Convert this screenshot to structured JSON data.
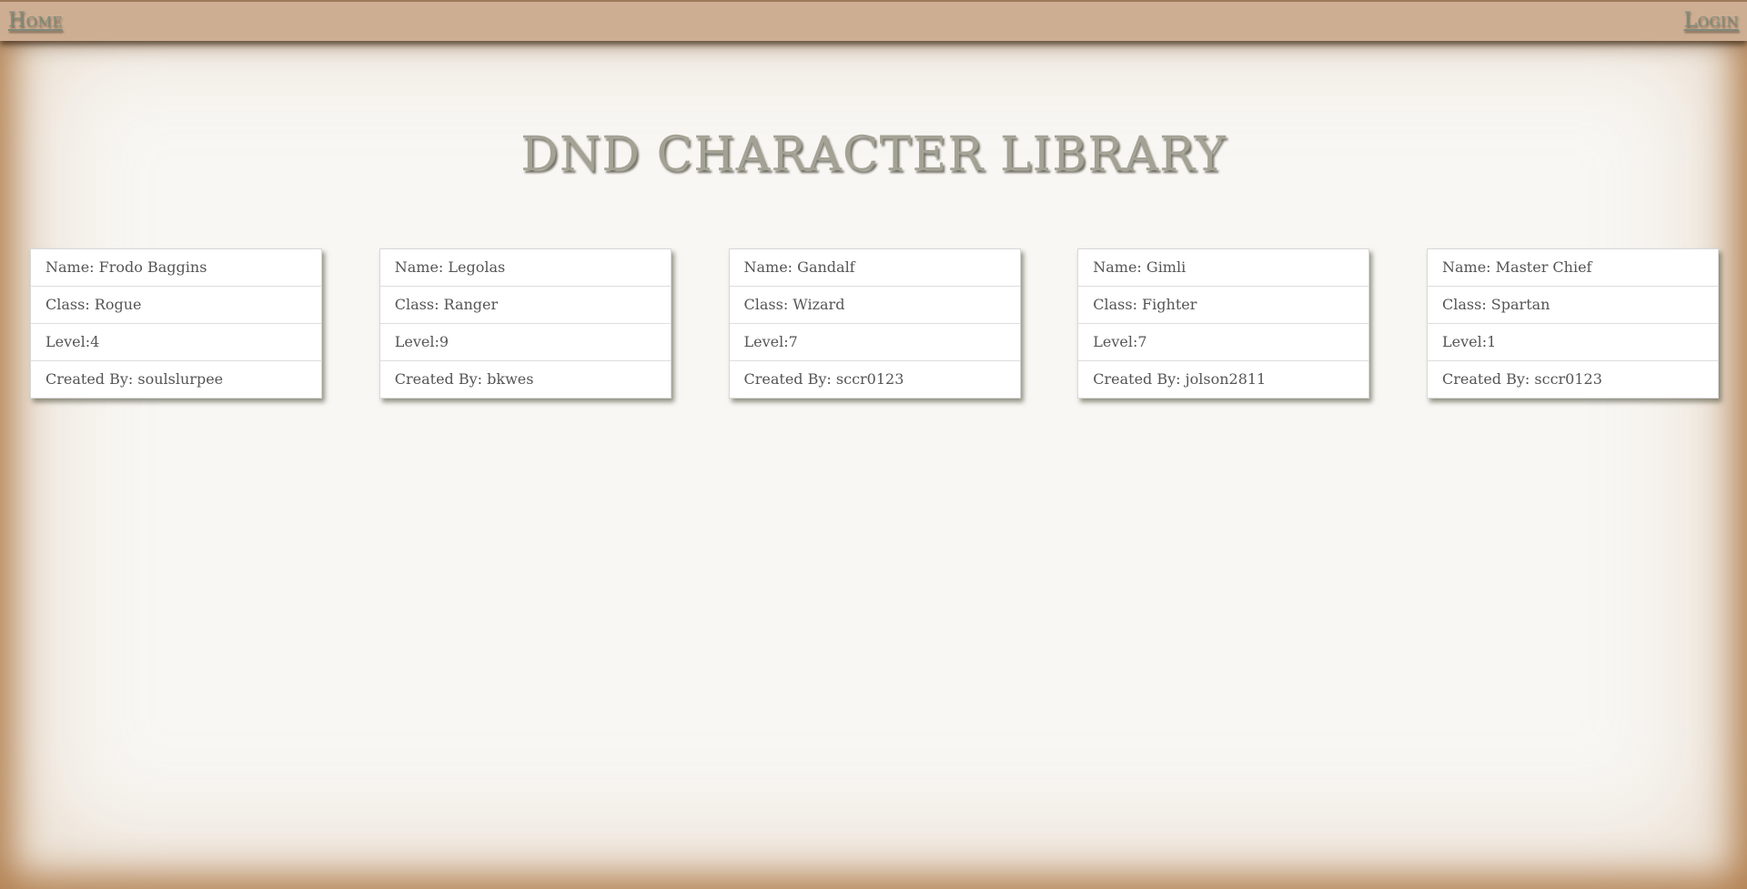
{
  "nav": {
    "home": "Home",
    "login": "Login"
  },
  "page": {
    "title": "DND CHARACTER LIBRARY"
  },
  "characters": [
    {
      "name": "Name: Frodo Baggins",
      "class": "Class: Rogue",
      "level": "Level:4",
      "created_by": "Created By: soulslurpee"
    },
    {
      "name": "Name: Legolas",
      "class": "Class: Ranger",
      "level": "Level:9",
      "created_by": "Created By: bkwes"
    },
    {
      "name": "Name: Gandalf",
      "class": "Class: Wizard",
      "level": "Level:7",
      "created_by": "Created By: sccr0123"
    },
    {
      "name": "Name: Gimli",
      "class": "Class: Fighter",
      "level": "Level:7",
      "created_by": "Created By: jolson2811"
    },
    {
      "name": "Name: Master Chief",
      "class": "Class: Spartan",
      "level": "Level:1",
      "created_by": "Created By: sccr0123"
    }
  ],
  "colors": {
    "navbar": "#cdae92",
    "background": "#f8f7f4",
    "title": "#a3a294",
    "vignette": "#a8703a"
  }
}
